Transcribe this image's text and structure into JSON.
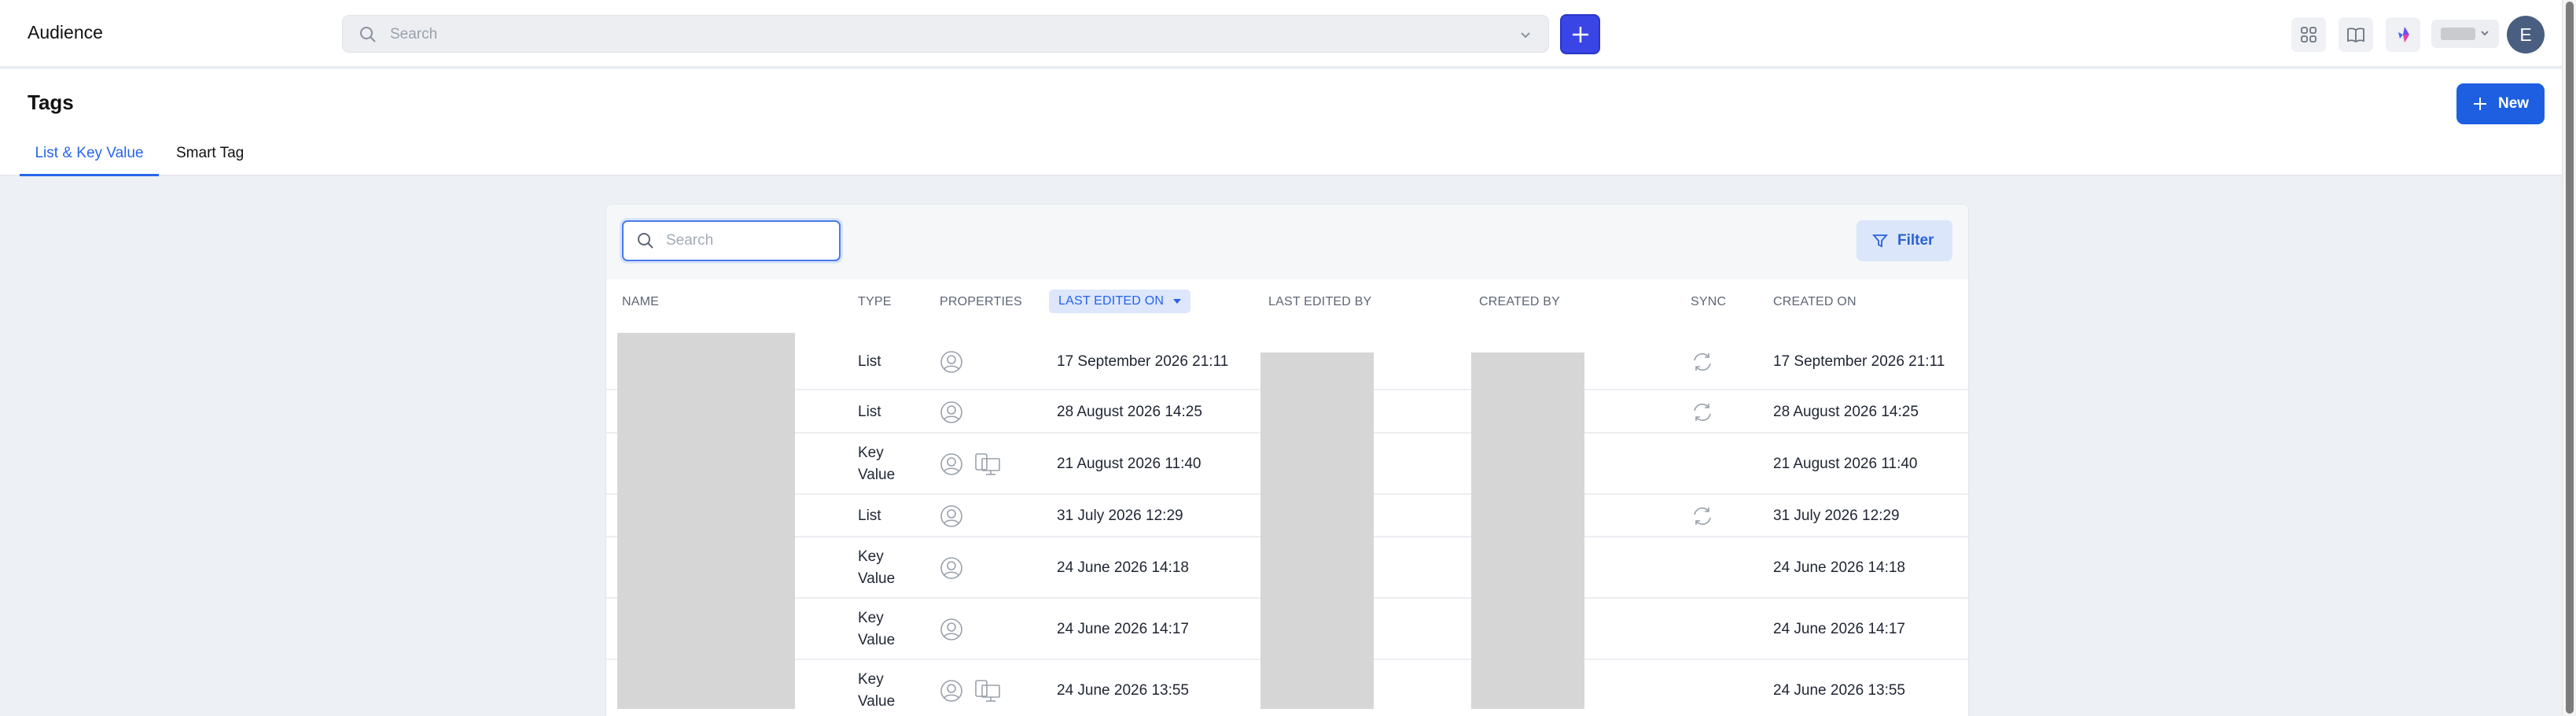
{
  "app": {
    "title": "Audience"
  },
  "topbar": {
    "search_placeholder": "Search",
    "add_label": "+",
    "icons": [
      "apps-icon",
      "book-icon",
      "brand-icon"
    ],
    "avatar_initial": "E"
  },
  "page": {
    "title": "Tags",
    "new_button": "New",
    "tabs": [
      {
        "label": "List & Key Value",
        "active": true
      },
      {
        "label": "Smart Tag",
        "active": false
      }
    ]
  },
  "table": {
    "search_placeholder": "Search",
    "filter_label": "Filter",
    "columns": {
      "name": "NAME",
      "type": "TYPE",
      "properties": "PROPERTIES",
      "last_edited_on": "LAST EDITED ON",
      "last_edited_by": "LAST EDITED BY",
      "created_by": "CREATED BY",
      "sync": "SYNC",
      "created_on": "CREATED ON"
    },
    "sorted_column": "last_edited_on",
    "rows": [
      {
        "type": "List",
        "properties": [
          "user-icon"
        ],
        "last_edited_on": "17 September 2026 21:11",
        "sync": true,
        "created_on": "17 September 2026 21:11"
      },
      {
        "type": "List",
        "properties": [
          "user-icon"
        ],
        "last_edited_on": "28 August 2026 14:25",
        "sync": true,
        "created_on": "28 August 2026 14:25"
      },
      {
        "type_line1": "Key",
        "type_line2": "Value",
        "properties": [
          "user-icon",
          "device-icon"
        ],
        "last_edited_on": "21 August 2026 11:40",
        "sync": false,
        "created_on": "21 August 2026 11:40"
      },
      {
        "type": "List",
        "properties": [
          "user-icon"
        ],
        "last_edited_on": "31 July 2026 12:29",
        "sync": true,
        "created_on": "31 July 2026 12:29"
      },
      {
        "type_line1": "Key",
        "type_line2": "Value",
        "properties": [
          "user-icon"
        ],
        "last_edited_on": "24 June 2026 14:18",
        "sync": false,
        "created_on": "24 June 2026 14:18"
      },
      {
        "type_line1": "Key",
        "type_line2": "Value",
        "properties": [
          "user-icon"
        ],
        "last_edited_on": "24 June 2026 14:17",
        "sync": false,
        "created_on": "24 June 2026 14:17"
      },
      {
        "type_line1": "Key",
        "type_line2": "Value",
        "properties": [
          "user-icon",
          "device-icon"
        ],
        "last_edited_on": "24 June 2026 13:55",
        "sync": false,
        "created_on": "24 June 2026 13:55"
      }
    ]
  },
  "colors": {
    "accent": "#1d5fe0",
    "add_button": "#3a45e6",
    "avatar": "#4a5f80"
  }
}
